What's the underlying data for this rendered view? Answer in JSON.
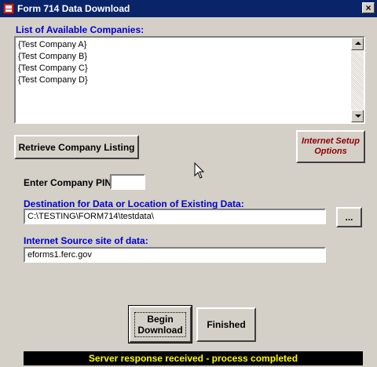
{
  "window": {
    "title": "Form 714 Data Download",
    "close_glyph": "×"
  },
  "companies": {
    "label": "List of Available Companies:",
    "items": [
      "{Test Company A}",
      "{Test Company B}",
      "{Test Company C}",
      "{Test Company D}"
    ]
  },
  "buttons": {
    "retrieve": "Retrieve Company Listing",
    "internet_line1": "Internet Setup",
    "internet_line2": "Options",
    "browse": "...",
    "begin_line1": "Begin",
    "begin_line2": "Download",
    "finished": "Finished"
  },
  "pin": {
    "label": "Enter Company PIN:",
    "value": ""
  },
  "destination": {
    "label": "Destination for Data or Location of Existing Data:",
    "value": "C:\\TESTING\\FORM714\\testdata\\"
  },
  "source": {
    "label": "Internet Source site of data:",
    "value": "eforms1.ferc.gov"
  },
  "status": "Server response received - process completed",
  "icons": {
    "app": "form-app-icon",
    "cursor": "arrow-cursor-icon"
  }
}
